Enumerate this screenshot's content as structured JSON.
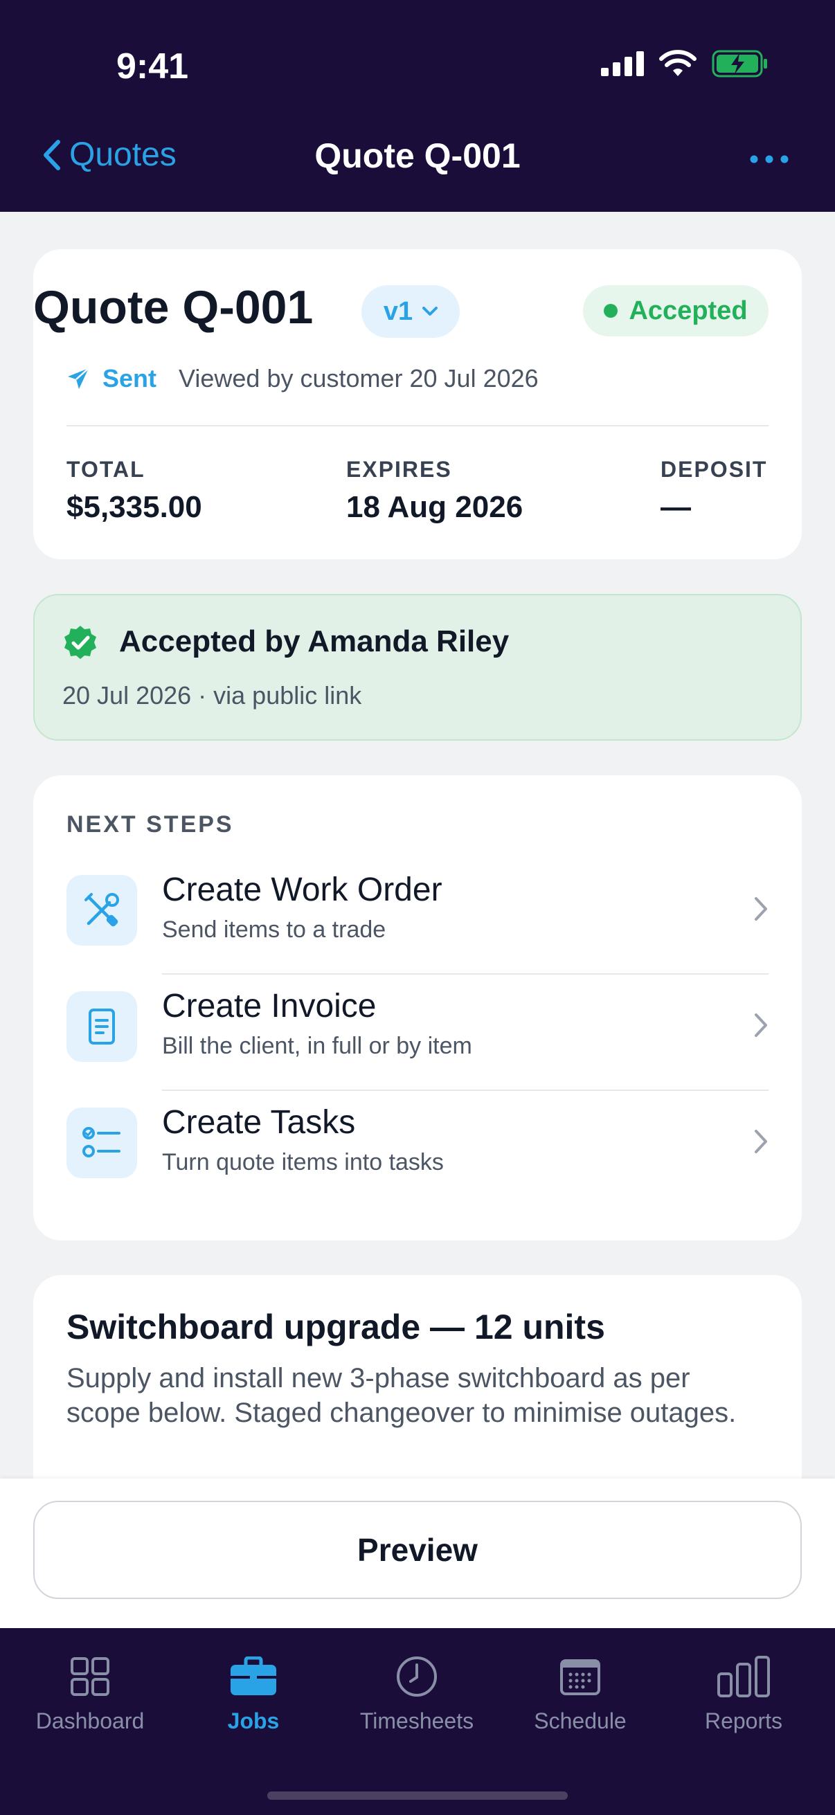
{
  "status_bar": {
    "time": "9:41"
  },
  "nav": {
    "back_label": "Quotes",
    "title": "Quote Q-001"
  },
  "quote": {
    "title": "Quote Q-001",
    "version": "v1",
    "status": "Accepted",
    "sent_label": "Sent",
    "viewed_text": "Viewed by customer 20 Jul 2026",
    "stats": [
      {
        "label": "TOTAL",
        "value": "$5,335.00"
      },
      {
        "label": "EXPIRES",
        "value": "18 Aug 2026"
      },
      {
        "label": "DEPOSIT",
        "value": "—"
      }
    ]
  },
  "acceptance": {
    "title": "Accepted by Amanda Riley",
    "subtitle": "20 Jul 2026 · via public link"
  },
  "next_steps": {
    "label": "NEXT STEPS",
    "items": [
      {
        "title": "Create Work Order",
        "subtitle": "Send items to a trade",
        "icon": "tools-icon"
      },
      {
        "title": "Create Invoice",
        "subtitle": "Bill the client, in full or by item",
        "icon": "invoice-icon"
      },
      {
        "title": "Create Tasks",
        "subtitle": "Turn quote items into tasks",
        "icon": "tasks-icon"
      }
    ]
  },
  "description": {
    "title": "Switchboard upgrade — 12 units",
    "body": "Supply and install new 3-phase switchboard as per scope below. Staged changeover to minimise outages."
  },
  "actions": {
    "preview_label": "Preview"
  },
  "tabs": [
    {
      "label": "Dashboard",
      "icon": "grid-icon",
      "active": false
    },
    {
      "label": "Jobs",
      "icon": "briefcase-icon",
      "active": true
    },
    {
      "label": "Timesheets",
      "icon": "clock-icon",
      "active": false
    },
    {
      "label": "Schedule",
      "icon": "calendar-icon",
      "active": false
    },
    {
      "label": "Reports",
      "icon": "bar-chart-icon",
      "active": false
    }
  ],
  "colors": {
    "accent": "#2aa3e6",
    "nav_bg": "#1a0d3a",
    "success": "#22b15a"
  }
}
